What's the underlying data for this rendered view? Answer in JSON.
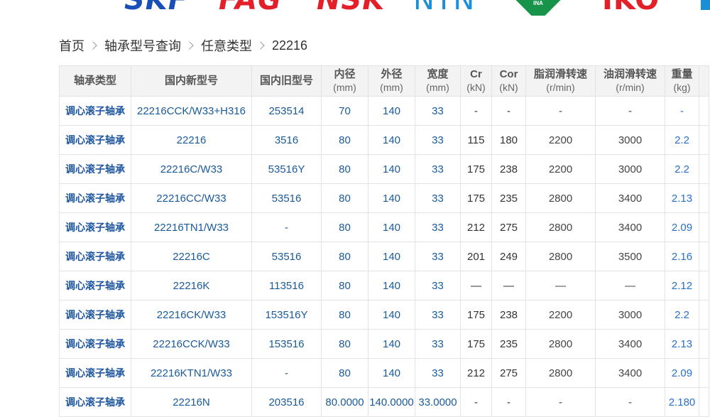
{
  "brands": [
    "SKF",
    "FAG",
    "NSK",
    "NTN",
    "INA",
    "IKO"
  ],
  "breadcrumb": {
    "items": [
      "首页",
      "轴承型号查询",
      "任意类型"
    ],
    "current": "22216"
  },
  "table": {
    "headers": [
      {
        "label": "轴承类型",
        "unit": ""
      },
      {
        "label": "国内新型号",
        "unit": ""
      },
      {
        "label": "国内旧型号",
        "unit": ""
      },
      {
        "label": "内径",
        "unit": "(mm)"
      },
      {
        "label": "外径",
        "unit": "(mm)"
      },
      {
        "label": "宽度",
        "unit": "(mm)"
      },
      {
        "label": "Cr",
        "unit": "(kN)"
      },
      {
        "label": "Cor",
        "unit": "(kN)"
      },
      {
        "label": "脂润滑转速",
        "unit": "(r/min)"
      },
      {
        "label": "油润滑转速",
        "unit": "(r/min)"
      },
      {
        "label": "重量",
        "unit": "(kg)"
      }
    ],
    "rows": [
      [
        "调心滚子轴承",
        "22216CCK/W33+H316",
        "253514",
        "70",
        "140",
        "33",
        "-",
        "-",
        "-",
        "-",
        "-"
      ],
      [
        "调心滚子轴承",
        "22216",
        "3516",
        "80",
        "140",
        "33",
        "115",
        "180",
        "2200",
        "3000",
        "2.2"
      ],
      [
        "调心滚子轴承",
        "22216C/W33",
        "53516Y",
        "80",
        "140",
        "33",
        "175",
        "238",
        "2200",
        "3000",
        "2.2"
      ],
      [
        "调心滚子轴承",
        "22216CC/W33",
        "53516",
        "80",
        "140",
        "33",
        "175",
        "235",
        "2800",
        "3400",
        "2.13"
      ],
      [
        "调心滚子轴承",
        "22216TN1/W33",
        "-",
        "80",
        "140",
        "33",
        "212",
        "275",
        "2800",
        "3400",
        "2.09"
      ],
      [
        "调心滚子轴承",
        "22216C",
        "53516",
        "80",
        "140",
        "33",
        "201",
        "249",
        "2800",
        "3500",
        "2.16"
      ],
      [
        "调心滚子轴承",
        "22216K",
        "113516",
        "80",
        "140",
        "33",
        "—",
        "—",
        "—",
        "—",
        "2.12"
      ],
      [
        "调心滚子轴承",
        "22216CK/W33",
        "153516Y",
        "80",
        "140",
        "33",
        "175",
        "238",
        "2200",
        "3000",
        "2.2"
      ],
      [
        "调心滚子轴承",
        "22216CCK/W33",
        "153516",
        "80",
        "140",
        "33",
        "175",
        "235",
        "2800",
        "3400",
        "2.13"
      ],
      [
        "调心滚子轴承",
        "22216KTN1/W33",
        "-",
        "80",
        "140",
        "33",
        "212",
        "275",
        "2800",
        "3400",
        "2.09"
      ],
      [
        "调心滚子轴承",
        "22216N",
        "203516",
        "80.0000",
        "140.0000",
        "33.0000",
        "-",
        "-",
        "-",
        "-",
        "2.180"
      ]
    ]
  },
  "colors": {
    "type_link": "#1e56a0",
    "value_blue": "#1a5a99",
    "header_bg": "#f3f3f3",
    "border": "#e3e3e3"
  }
}
